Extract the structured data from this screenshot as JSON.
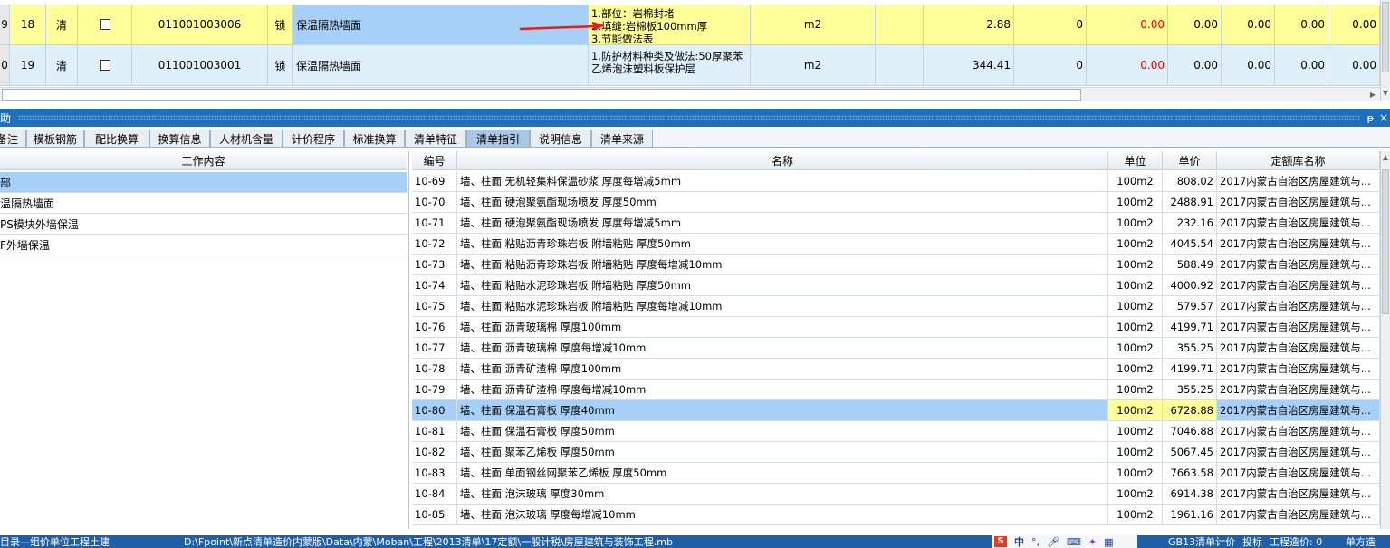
{
  "top_grid": {
    "rows": [
      {
        "row_header": "9",
        "index": "18",
        "type": "清",
        "code": "011001003006",
        "lock": "锁",
        "name": "保温隔热墙面",
        "feature_lines": [
          "1.部位：岩棉封堵",
          "2.填缝:岩棉板100mm厚",
          "3.节能做法表"
        ],
        "unit": "m2",
        "quantity": "2.88",
        "v1": "0",
        "v2": "0.00",
        "v3": "0.00",
        "v4": "0.00",
        "v5": "0.00",
        "v6": "0.00"
      },
      {
        "row_header": "0",
        "index": "19",
        "type": "清",
        "code": "011001003001",
        "lock": "锁",
        "name": "保温隔热墙面",
        "feature_lines": [
          "1.防护材料种类及做法:50厚聚苯",
          "乙烯泡沫塑料板保护层"
        ],
        "unit": "m2",
        "quantity": "344.41",
        "v1": "0",
        "v2": "0.00",
        "v3": "0.00",
        "v4": "0.00",
        "v5": "0.00",
        "v6": "0.00"
      }
    ]
  },
  "panel": {
    "title": "助",
    "pin": "ᵽ",
    "close": "×"
  },
  "tabs": [
    "备注",
    "模板钢筋",
    "配比换算",
    "换算信息",
    "人材机含量",
    "计价程序",
    "标准换算",
    "清单特征",
    "清单指引",
    "说明信息",
    "清单来源"
  ],
  "tab_clip_first": "备注",
  "active_tab": "清单指引",
  "work_content": {
    "header": "工作内容",
    "items": [
      "部",
      "温隔热墙面",
      "PS模块外墙保温",
      "F外墙保温"
    ]
  },
  "quota_table": {
    "headers": {
      "code": "编号",
      "name": "名称",
      "unit": "单位",
      "price": "单价",
      "lib": "定额库名称"
    },
    "rows": [
      {
        "code": "10-69",
        "name": "墙、柱面 无机轻集料保温砂浆 厚度每增减5mm",
        "unit": "100m2",
        "price": "808.02",
        "lib": "2017内蒙古自治区房屋建筑与..."
      },
      {
        "code": "10-70",
        "name": "墙、柱面 硬泡聚氨酯现场喷发 厚度50mm",
        "unit": "100m2",
        "price": "2488.91",
        "lib": "2017内蒙古自治区房屋建筑与..."
      },
      {
        "code": "10-71",
        "name": "墙、柱面 硬泡聚氨酯现场喷发 厚度每增减5mm",
        "unit": "100m2",
        "price": "232.16",
        "lib": "2017内蒙古自治区房屋建筑与..."
      },
      {
        "code": "10-72",
        "name": "墙、柱面 粘贴沥青珍珠岩板 附墙粘贴 厚度50mm",
        "unit": "100m2",
        "price": "4045.54",
        "lib": "2017内蒙古自治区房屋建筑与..."
      },
      {
        "code": "10-73",
        "name": "墙、柱面 粘贴沥青珍珠岩板 附墙粘贴 厚度每增减10mm",
        "unit": "100m2",
        "price": "588.49",
        "lib": "2017内蒙古自治区房屋建筑与..."
      },
      {
        "code": "10-74",
        "name": "墙、柱面 粘贴水泥珍珠岩板 附墙粘贴 厚度50mm",
        "unit": "100m2",
        "price": "4000.92",
        "lib": "2017内蒙古自治区房屋建筑与..."
      },
      {
        "code": "10-75",
        "name": "墙、柱面 粘贴水泥珍珠岩板 附墙粘贴 厚度每增减10mm",
        "unit": "100m2",
        "price": "579.57",
        "lib": "2017内蒙古自治区房屋建筑与..."
      },
      {
        "code": "10-76",
        "name": "墙、柱面 沥青玻璃棉 厚度100mm",
        "unit": "100m2",
        "price": "4199.71",
        "lib": "2017内蒙古自治区房屋建筑与..."
      },
      {
        "code": "10-77",
        "name": "墙、柱面 沥青玻璃棉 厚度每增减10mm",
        "unit": "100m2",
        "price": "355.25",
        "lib": "2017内蒙古自治区房屋建筑与..."
      },
      {
        "code": "10-78",
        "name": "墙、柱面 沥青矿渣棉 厚度100mm",
        "unit": "100m2",
        "price": "4199.71",
        "lib": "2017内蒙古自治区房屋建筑与..."
      },
      {
        "code": "10-79",
        "name": "墙、柱面 沥青矿渣棉 厚度每增减10mm",
        "unit": "100m2",
        "price": "355.25",
        "lib": "2017内蒙古自治区房屋建筑与..."
      },
      {
        "code": "10-80",
        "name": "墙、柱面 保温石膏板 厚度40mm",
        "unit": "100m2",
        "price": "6728.88",
        "lib": "2017内蒙古自治区房屋建筑与..."
      },
      {
        "code": "10-81",
        "name": "墙、柱面 保温石膏板 厚度50mm",
        "unit": "100m2",
        "price": "7046.88",
        "lib": "2017内蒙古自治区房屋建筑与..."
      },
      {
        "code": "10-82",
        "name": "墙、柱面 聚苯乙烯板 厚度50mm",
        "unit": "100m2",
        "price": "5067.45",
        "lib": "2017内蒙古自治区房屋建筑与..."
      },
      {
        "code": "10-83",
        "name": "墙、柱面 单面钢丝网聚苯乙烯板 厚度50mm",
        "unit": "100m2",
        "price": "7663.58",
        "lib": "2017内蒙古自治区房屋建筑与..."
      },
      {
        "code": "10-84",
        "name": "墙、柱面 泡沫玻璃 厚度30mm",
        "unit": "100m2",
        "price": "6914.38",
        "lib": "2017内蒙古自治区房屋建筑与..."
      },
      {
        "code": "10-85",
        "name": "墙、柱面 泡沫玻璃 厚度每增减10mm",
        "unit": "100m2",
        "price": "1961.16",
        "lib": "2017内蒙古自治区房屋建筑与..."
      }
    ],
    "selected_code": "10-80"
  },
  "status_bar": {
    "left": "目录—组价单位工程土建",
    "path": "D:\\Fpoint\\新点清单造价内蒙版\\Data\\内蒙\\Moban\\工程\\2013清单\\17定额\\一般计税\\房屋建筑与装饰工程.mb",
    "ime": "中",
    "right1": "GB13清单计价",
    "right2": "投标",
    "right3": "工程造价: 0",
    "right4": "单方造"
  },
  "colors": {
    "accent": "#1f6fbf",
    "selected": "#a6d0f7",
    "yellow": "#ffff99",
    "status": "#1f5fa8"
  }
}
